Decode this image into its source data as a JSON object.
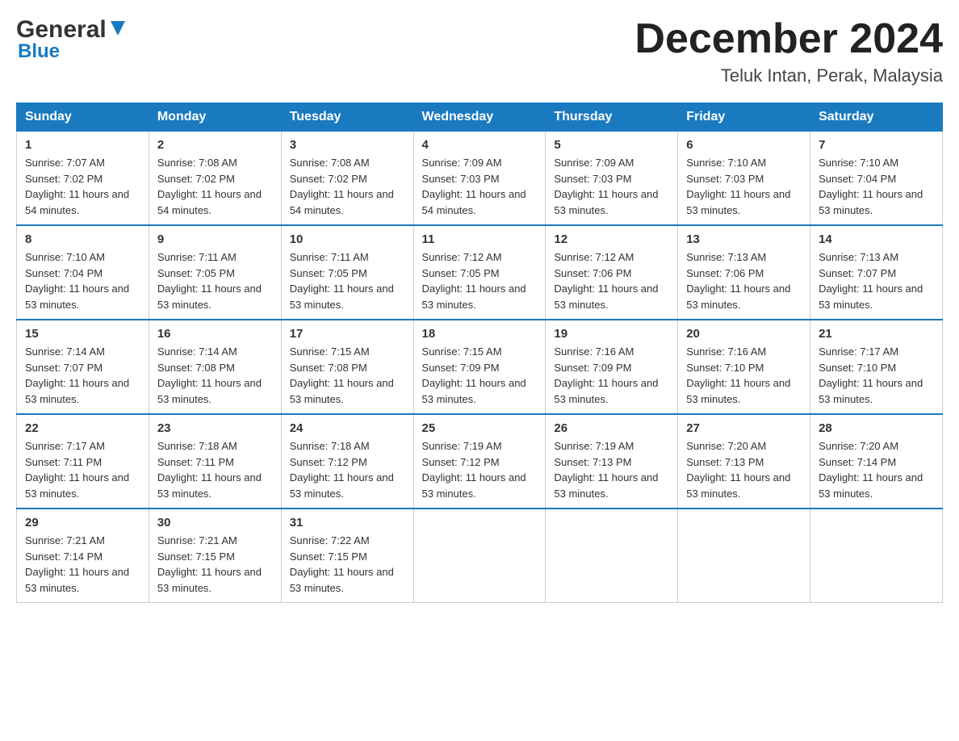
{
  "header": {
    "logo_general": "General",
    "logo_blue": "Blue",
    "month_title": "December 2024",
    "location": "Teluk Intan, Perak, Malaysia"
  },
  "days_of_week": [
    "Sunday",
    "Monday",
    "Tuesday",
    "Wednesday",
    "Thursday",
    "Friday",
    "Saturday"
  ],
  "weeks": [
    [
      {
        "day": "1",
        "sunrise": "7:07 AM",
        "sunset": "7:02 PM",
        "daylight": "11 hours and 54 minutes."
      },
      {
        "day": "2",
        "sunrise": "7:08 AM",
        "sunset": "7:02 PM",
        "daylight": "11 hours and 54 minutes."
      },
      {
        "day": "3",
        "sunrise": "7:08 AM",
        "sunset": "7:02 PM",
        "daylight": "11 hours and 54 minutes."
      },
      {
        "day": "4",
        "sunrise": "7:09 AM",
        "sunset": "7:03 PM",
        "daylight": "11 hours and 54 minutes."
      },
      {
        "day": "5",
        "sunrise": "7:09 AM",
        "sunset": "7:03 PM",
        "daylight": "11 hours and 53 minutes."
      },
      {
        "day": "6",
        "sunrise": "7:10 AM",
        "sunset": "7:03 PM",
        "daylight": "11 hours and 53 minutes."
      },
      {
        "day": "7",
        "sunrise": "7:10 AM",
        "sunset": "7:04 PM",
        "daylight": "11 hours and 53 minutes."
      }
    ],
    [
      {
        "day": "8",
        "sunrise": "7:10 AM",
        "sunset": "7:04 PM",
        "daylight": "11 hours and 53 minutes."
      },
      {
        "day": "9",
        "sunrise": "7:11 AM",
        "sunset": "7:05 PM",
        "daylight": "11 hours and 53 minutes."
      },
      {
        "day": "10",
        "sunrise": "7:11 AM",
        "sunset": "7:05 PM",
        "daylight": "11 hours and 53 minutes."
      },
      {
        "day": "11",
        "sunrise": "7:12 AM",
        "sunset": "7:05 PM",
        "daylight": "11 hours and 53 minutes."
      },
      {
        "day": "12",
        "sunrise": "7:12 AM",
        "sunset": "7:06 PM",
        "daylight": "11 hours and 53 minutes."
      },
      {
        "day": "13",
        "sunrise": "7:13 AM",
        "sunset": "7:06 PM",
        "daylight": "11 hours and 53 minutes."
      },
      {
        "day": "14",
        "sunrise": "7:13 AM",
        "sunset": "7:07 PM",
        "daylight": "11 hours and 53 minutes."
      }
    ],
    [
      {
        "day": "15",
        "sunrise": "7:14 AM",
        "sunset": "7:07 PM",
        "daylight": "11 hours and 53 minutes."
      },
      {
        "day": "16",
        "sunrise": "7:14 AM",
        "sunset": "7:08 PM",
        "daylight": "11 hours and 53 minutes."
      },
      {
        "day": "17",
        "sunrise": "7:15 AM",
        "sunset": "7:08 PM",
        "daylight": "11 hours and 53 minutes."
      },
      {
        "day": "18",
        "sunrise": "7:15 AM",
        "sunset": "7:09 PM",
        "daylight": "11 hours and 53 minutes."
      },
      {
        "day": "19",
        "sunrise": "7:16 AM",
        "sunset": "7:09 PM",
        "daylight": "11 hours and 53 minutes."
      },
      {
        "day": "20",
        "sunrise": "7:16 AM",
        "sunset": "7:10 PM",
        "daylight": "11 hours and 53 minutes."
      },
      {
        "day": "21",
        "sunrise": "7:17 AM",
        "sunset": "7:10 PM",
        "daylight": "11 hours and 53 minutes."
      }
    ],
    [
      {
        "day": "22",
        "sunrise": "7:17 AM",
        "sunset": "7:11 PM",
        "daylight": "11 hours and 53 minutes."
      },
      {
        "day": "23",
        "sunrise": "7:18 AM",
        "sunset": "7:11 PM",
        "daylight": "11 hours and 53 minutes."
      },
      {
        "day": "24",
        "sunrise": "7:18 AM",
        "sunset": "7:12 PM",
        "daylight": "11 hours and 53 minutes."
      },
      {
        "day": "25",
        "sunrise": "7:19 AM",
        "sunset": "7:12 PM",
        "daylight": "11 hours and 53 minutes."
      },
      {
        "day": "26",
        "sunrise": "7:19 AM",
        "sunset": "7:13 PM",
        "daylight": "11 hours and 53 minutes."
      },
      {
        "day": "27",
        "sunrise": "7:20 AM",
        "sunset": "7:13 PM",
        "daylight": "11 hours and 53 minutes."
      },
      {
        "day": "28",
        "sunrise": "7:20 AM",
        "sunset": "7:14 PM",
        "daylight": "11 hours and 53 minutes."
      }
    ],
    [
      {
        "day": "29",
        "sunrise": "7:21 AM",
        "sunset": "7:14 PM",
        "daylight": "11 hours and 53 minutes."
      },
      {
        "day": "30",
        "sunrise": "7:21 AM",
        "sunset": "7:15 PM",
        "daylight": "11 hours and 53 minutes."
      },
      {
        "day": "31",
        "sunrise": "7:22 AM",
        "sunset": "7:15 PM",
        "daylight": "11 hours and 53 minutes."
      },
      null,
      null,
      null,
      null
    ]
  ],
  "labels": {
    "sunrise": "Sunrise:",
    "sunset": "Sunset:",
    "daylight": "Daylight:"
  }
}
